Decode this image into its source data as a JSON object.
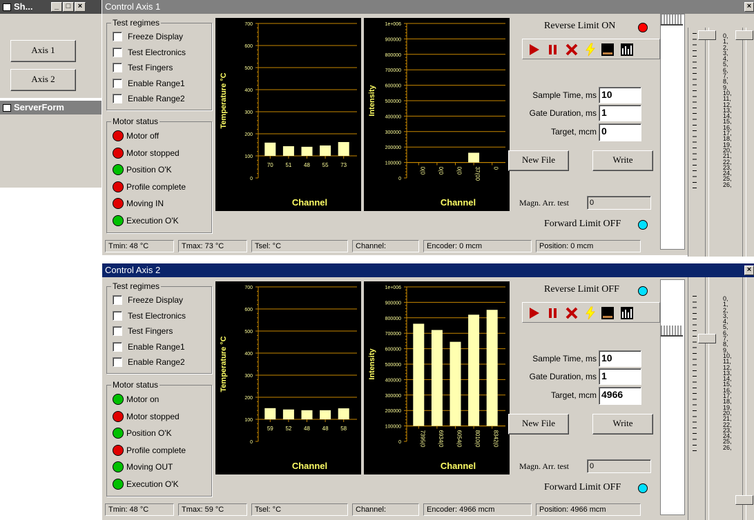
{
  "small_window": {
    "title": "Sh...",
    "buttons": [
      "Axis 1",
      "Axis 2"
    ]
  },
  "server_form": {
    "title": "ServerForm"
  },
  "axes": [
    {
      "title": "Control Axis 1",
      "test_regimes": {
        "caption": "Test regimes",
        "items": [
          "Freeze Display",
          "Test Electronics",
          "Test Fingers",
          "Enable Range1",
          "Enable Range2"
        ]
      },
      "motor_status": {
        "caption": "Motor status",
        "items": [
          {
            "label": "Motor off",
            "color": "#e00000"
          },
          {
            "label": "Motor stopped",
            "color": "#e00000"
          },
          {
            "label": "Position O'K",
            "color": "#00c000"
          },
          {
            "label": "Profile complete",
            "color": "#e00000"
          },
          {
            "label": "Moving IN",
            "color": "#e00000"
          },
          {
            "label": "Execution O'K",
            "color": "#00c000"
          }
        ]
      },
      "reverse_limit": "Reverse Limit ON",
      "reverse_color": "#ff0000",
      "forward_limit": "Forward Limit OFF",
      "forward_color": "#00e0ff",
      "sample_label": "Sample Time, ms",
      "sample_value": "10",
      "gate_label": "Gate Duration, ms",
      "gate_value": "1",
      "target_label": "Target, mcm",
      "target_value": "0",
      "new_file": "New File",
      "write": "Write",
      "magn_label": "Magn. Arr. test",
      "magn_value": "0",
      "status": [
        "Tmin: 48  °C",
        "Tmax: 73  °C",
        "Tsel:      °C",
        "Channel:",
        "Encoder: 0      mcm",
        "Position: 0      mcm"
      ],
      "temp_chart": {
        "ylabel": "Temperature °C",
        "xlabel": "Channel",
        "ticks": [
          "700",
          "600",
          "500",
          "400",
          "300",
          "200",
          "100",
          "0"
        ],
        "values": [
          70,
          51,
          48,
          55,
          73
        ],
        "labels": [
          "70",
          "51",
          "48",
          "55",
          "73"
        ]
      },
      "int_chart": {
        "ylabel": "Intensity",
        "xlabel": "Channel",
        "ticks": [
          "1e+006",
          "900000",
          "800000",
          "700000",
          "600000",
          "500000",
          "400000",
          "300000",
          "200000",
          "100000",
          "0"
        ],
        "values": [
          0,
          0,
          0,
          70000,
          0
        ],
        "labels": [
          "0(0",
          "0(0",
          "0(0",
          "37(00",
          "0"
        ]
      }
    },
    {
      "title": "Control Axis 2",
      "test_regimes": {
        "caption": "Test regimes",
        "items": [
          "Freeze Display",
          "Test Electronics",
          "Test Fingers",
          "Enable Range1",
          "Enable Range2"
        ]
      },
      "motor_status": {
        "caption": "Motor status",
        "items": [
          {
            "label": "Motor on",
            "color": "#00c000"
          },
          {
            "label": "Motor stopped",
            "color": "#e00000"
          },
          {
            "label": "Position O'K",
            "color": "#00c000"
          },
          {
            "label": "Profile complete",
            "color": "#e00000"
          },
          {
            "label": "Moving OUT",
            "color": "#00c000"
          },
          {
            "label": "Execution O'K",
            "color": "#00c000"
          }
        ]
      },
      "reverse_limit": "Reverse Limit OFF",
      "reverse_color": "#00e0ff",
      "forward_limit": "Forward Limit OFF",
      "forward_color": "#00e0ff",
      "sample_label": "Sample Time, ms",
      "sample_value": "10",
      "gate_label": "Gate Duration, ms",
      "gate_value": "1",
      "target_label": "Target, mcm",
      "target_value": "4966",
      "new_file": "New File",
      "write": "Write",
      "magn_label": "Magn. Arr. test",
      "magn_value": "0",
      "status": [
        "Tmin: 48  °C",
        "Tmax: 59  °C",
        "Tsel:      °C",
        "Channel:",
        "Encoder: 4966   mcm",
        "Position: 4966   mcm"
      ],
      "temp_chart": {
        "ylabel": "Temperature °C",
        "xlabel": "Channel",
        "ticks": [
          "700",
          "600",
          "500",
          "400",
          "300",
          "200",
          "100",
          "0"
        ],
        "values": [
          59,
          52,
          48,
          48,
          58
        ],
        "labels": [
          "59",
          "52",
          "48",
          "48",
          "58"
        ]
      },
      "int_chart": {
        "ylabel": "Intensity",
        "xlabel": "Channel",
        "ticks": [
          "1e+006",
          "900000",
          "800000",
          "700000",
          "600000",
          "500000",
          "400000",
          "300000",
          "200000",
          "100000",
          "0"
        ],
        "values": [
          735000,
          690000,
          605000,
          800000,
          835000
        ],
        "labels": [
          "7395(0",
          "6934(0",
          "6054(0",
          "8010(0",
          "8342(0"
        ]
      }
    }
  ],
  "scale_labels": [
    "0,",
    "1,",
    "2,",
    "3,",
    "4,",
    "5,",
    "6,",
    "7,",
    "8,",
    "9,",
    "10,",
    "11,",
    "12,",
    "13,",
    "14,",
    "15,",
    "16,",
    "17,",
    "18,",
    "19,",
    "20,",
    "21,",
    "22,",
    "23,",
    "24,",
    "25,",
    "26,"
  ],
  "chart_data": [
    {
      "type": "bar",
      "title": "",
      "xlabel": "Channel",
      "ylabel": "Temperature °C",
      "categories": [
        "70",
        "51",
        "48",
        "55",
        "73"
      ],
      "values": [
        70,
        51,
        48,
        55,
        73
      ],
      "ylim": [
        0,
        700
      ]
    },
    {
      "type": "bar",
      "title": "",
      "xlabel": "Channel",
      "ylabel": "Intensity",
      "categories": [
        "0(0",
        "0(0",
        "0(0",
        "37(00",
        "0"
      ],
      "values": [
        0,
        0,
        0,
        70000,
        0
      ],
      "ylim": [
        0,
        1000000
      ]
    },
    {
      "type": "bar",
      "title": "",
      "xlabel": "Channel",
      "ylabel": "Temperature °C",
      "categories": [
        "59",
        "52",
        "48",
        "48",
        "58"
      ],
      "values": [
        59,
        52,
        48,
        48,
        58
      ],
      "ylim": [
        0,
        700
      ]
    },
    {
      "type": "bar",
      "title": "",
      "xlabel": "Channel",
      "ylabel": "Intensity",
      "categories": [
        "7395(0",
        "6934(0",
        "6054(0",
        "8010(0",
        "8342(0"
      ],
      "values": [
        735000,
        690000,
        605000,
        800000,
        835000
      ],
      "ylim": [
        0,
        1000000
      ]
    }
  ]
}
